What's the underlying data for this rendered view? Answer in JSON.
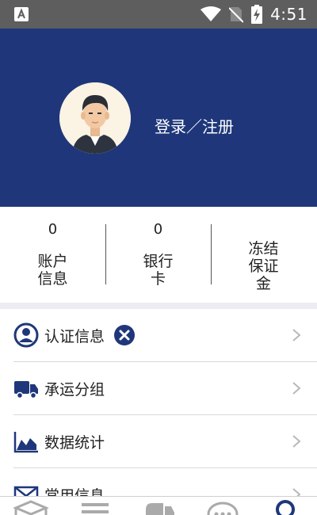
{
  "status_bar": {
    "time": "4:51",
    "icons": [
      "app-notification-icon",
      "wifi-icon",
      "no-sim-icon",
      "battery-charging-icon"
    ]
  },
  "profile": {
    "login_label": "登录／注册",
    "avatar_icon": "user-avatar-icon"
  },
  "stats": [
    {
      "value": "0",
      "label": "账户\n信息"
    },
    {
      "value": "0",
      "label": "银行\n卡"
    },
    {
      "value": "",
      "label": "冻结\n保证\n金"
    }
  ],
  "menu": [
    {
      "label": "认证信息",
      "icon": "user-circle-icon",
      "badge": "close-circle-icon"
    },
    {
      "label": "承运分组",
      "icon": "truck-icon"
    },
    {
      "label": "数据统计",
      "icon": "area-chart-icon"
    },
    {
      "label": "常用信息",
      "icon": "envelope-icon"
    }
  ],
  "bottom_nav": [
    "cube-icon",
    "list-icon",
    "truck-icon",
    "chat-icon",
    "user-search-icon"
  ],
  "colors": {
    "header": "#1f377a",
    "accent": "#1f377a",
    "status_bar": "#5e5e5e"
  }
}
